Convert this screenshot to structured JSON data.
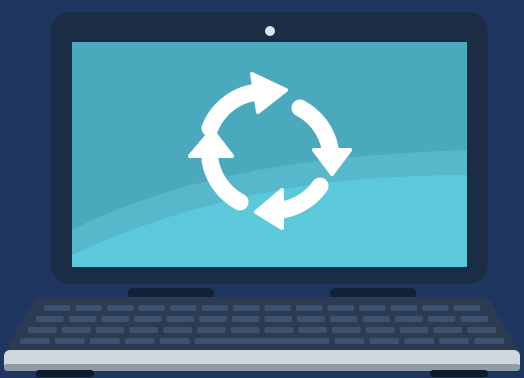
{
  "illustration": {
    "subject": "laptop",
    "screen_icon": "refresh-cycle-icon",
    "has_webcam": true
  },
  "colors": {
    "background": "#1e3560",
    "laptop_bezel": "#1b2d45",
    "screen_back": "#4aa9bd",
    "screen_front": "#5cc9da",
    "screen_glare": "#57b8cb",
    "icon": "#ffffff",
    "webcam": "#d9e4ec",
    "hinge": "#132236",
    "keyboard_deck": "#2b3b52",
    "keys": "#3e5270",
    "base_highlight": "#cfd6dc",
    "base_shadow": "#8f9ba6",
    "feet": "#0f1b2b"
  },
  "keyboard": {
    "rows": 4,
    "keys_per_row": 14
  }
}
